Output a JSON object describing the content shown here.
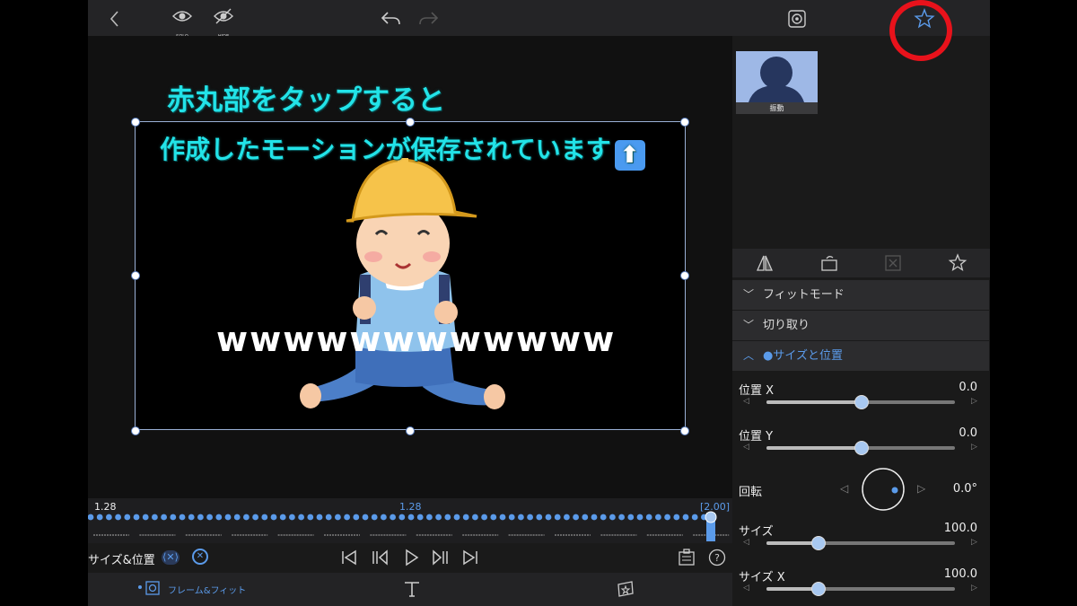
{
  "toolbar": {
    "back_icon": "chevron-left-icon",
    "solo_label": "SOLO",
    "hide_label": "HIDE",
    "undo_icon": "undo-icon",
    "redo_icon": "redo-icon",
    "target_icon": "target-icon",
    "favorite_icon": "star-icon"
  },
  "overlay": {
    "line1": "赤丸部をタップすると",
    "line2": "作成したモーションが保存されています",
    "canvas_text": "wwwwwwwwwwww"
  },
  "side": {
    "thumbnail_label": "振動",
    "tabs": [
      "flip-icon",
      "rotate-icon",
      "transform-icon",
      "star-icon"
    ],
    "sections": [
      {
        "label": "フィットモード",
        "expanded": false
      },
      {
        "label": "切り取り",
        "expanded": false
      },
      {
        "label": "●サイズと位置",
        "expanded": true
      }
    ],
    "params": {
      "pos_x": {
        "label": "位置 X",
        "value": "0.0",
        "level": 0.5
      },
      "pos_y": {
        "label": "位置 Y",
        "value": "0.0",
        "level": 0.5
      },
      "rotation": {
        "label": "回転",
        "value": "0.0°"
      },
      "size": {
        "label": "サイズ",
        "value": "100.0",
        "level": 0.27
      },
      "size_x": {
        "label": "サイズ X",
        "value": "100.0",
        "level": 0.27
      }
    }
  },
  "timeline": {
    "left_time": "1.28",
    "center_time": "1.28",
    "end_time": "[2.00]"
  },
  "controls": {
    "track_label": "サイズ&位置"
  },
  "bottom": {
    "frame_fit_label": "フレーム&フィット"
  },
  "colors": {
    "accent": "#5b9bea",
    "overlay_text": "#22e3e8",
    "highlight_circle": "#e8121b",
    "selection": "#9ab0d6"
  }
}
